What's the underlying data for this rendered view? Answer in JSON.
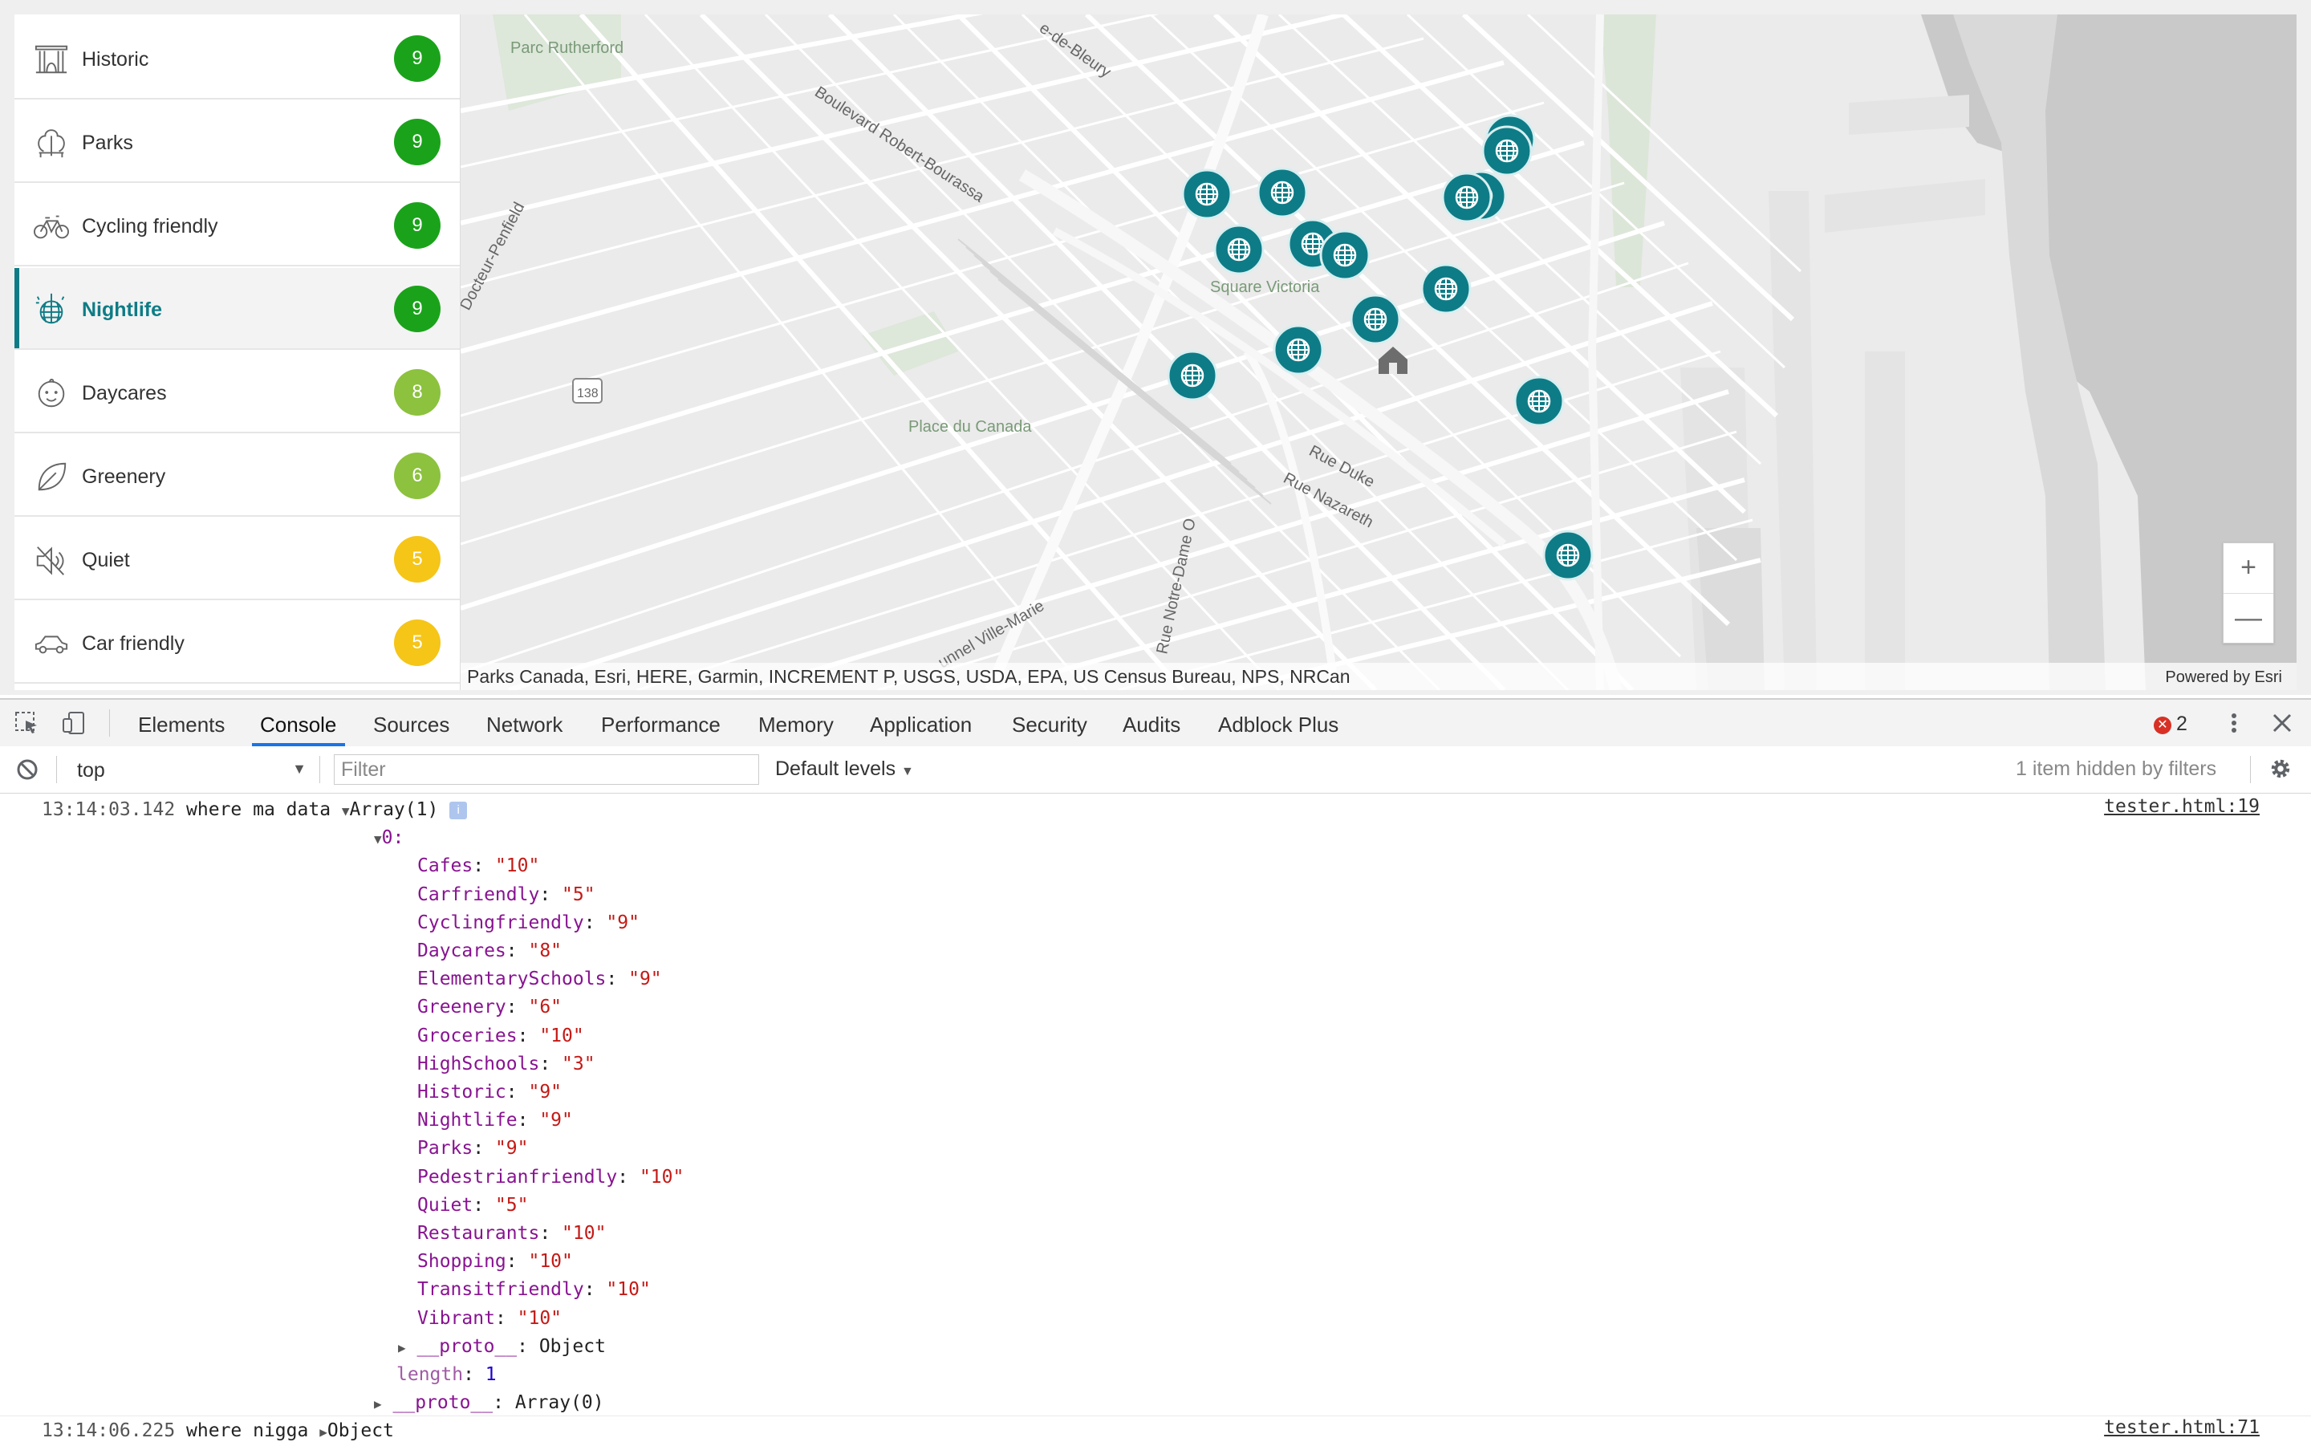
{
  "sidebar": {
    "items": [
      {
        "label": "Historic",
        "score": "9",
        "icon": "monument-icon",
        "color": "#1aa31a",
        "active": false
      },
      {
        "label": "Parks",
        "score": "9",
        "icon": "park-bench-icon",
        "color": "#1aa31a",
        "active": false
      },
      {
        "label": "Cycling friendly",
        "score": "9",
        "icon": "bicycle-icon",
        "color": "#1aa31a",
        "active": false
      },
      {
        "label": "Nightlife",
        "score": "9",
        "icon": "disco-ball-icon",
        "color": "#1aa31a",
        "active": true
      },
      {
        "label": "Daycares",
        "score": "8",
        "icon": "baby-face-icon",
        "color": "#8cc23e",
        "active": false
      },
      {
        "label": "Greenery",
        "score": "6",
        "icon": "leaf-icon",
        "color": "#8cc23e",
        "active": false
      },
      {
        "label": "Quiet",
        "score": "5",
        "icon": "mute-speaker-icon",
        "color": "#f5c518",
        "active": false
      },
      {
        "label": "Car friendly",
        "score": "5",
        "icon": "car-icon",
        "color": "#f5c518",
        "active": false
      }
    ]
  },
  "map": {
    "labels": {
      "parc_rutherford": "Parc Rutherford",
      "bleury": "e-de-Bleury",
      "robert_bourassa": "Boulevard Robert-Bourassa",
      "docteur_penfield": "Docteur-Penfield",
      "square_victoria": "Square Victoria",
      "place_du_canada": "Place du Canada",
      "route_138": "138",
      "rue_duke": "Rue Duke",
      "rue_nazareth": "Rue Nazareth",
      "notre_dame": "Rue Notre-Dame O",
      "ville_marie": "unnel Ville-Marie"
    },
    "zoom_in": "+",
    "zoom_out": "—",
    "attribution": "Parks Canada, Esri, HERE, Garmin, INCREMENT P, USGS, USDA, EPA, US Census Bureau, NPS, NRCan",
    "powered_prefix": "Powered by",
    "powered_brand": "Esri",
    "marker_color": "#0e7c86"
  },
  "devtools": {
    "tabs": [
      "Elements",
      "Console",
      "Sources",
      "Network",
      "Performance",
      "Memory",
      "Application",
      "Security",
      "Audits",
      "Adblock Plus"
    ],
    "active_tab": "Console",
    "error_count": "2",
    "context": "top",
    "filter_placeholder": "Filter",
    "levels": "Default levels",
    "hidden_note": "1 item hidden by filters"
  },
  "console": {
    "entry1": {
      "timestamp": "13:14:03.142",
      "message": "where ma data",
      "summary": "Array(1)",
      "source": "tester.html:19",
      "index_label": "0:",
      "properties": [
        {
          "key": "Cafes",
          "value": "\"10\""
        },
        {
          "key": "Carfriendly",
          "value": "\"5\""
        },
        {
          "key": "Cyclingfriendly",
          "value": "\"9\""
        },
        {
          "key": "Daycares",
          "value": "\"8\""
        },
        {
          "key": "ElementarySchools",
          "value": "\"9\""
        },
        {
          "key": "Greenery",
          "value": "\"6\""
        },
        {
          "key": "Groceries",
          "value": "\"10\""
        },
        {
          "key": "HighSchools",
          "value": "\"3\""
        },
        {
          "key": "Historic",
          "value": "\"9\""
        },
        {
          "key": "Nightlife",
          "value": "\"9\""
        },
        {
          "key": "Parks",
          "value": "\"9\""
        },
        {
          "key": "Pedestrianfriendly",
          "value": "\"10\""
        },
        {
          "key": "Quiet",
          "value": "\"5\""
        },
        {
          "key": "Restaurants",
          "value": "\"10\""
        },
        {
          "key": "Shopping",
          "value": "\"10\""
        },
        {
          "key": "Transitfriendly",
          "value": "\"10\""
        },
        {
          "key": "Vibrant",
          "value": "\"10\""
        }
      ],
      "proto_obj_key": "__proto__",
      "proto_obj_val": "Object",
      "length_key": "length",
      "length_val": "1",
      "proto_arr_key": "__proto__",
      "proto_arr_val": "Array(0)"
    },
    "entry2": {
      "timestamp": "13:14:06.225",
      "message": "where nigga",
      "summary": "Object",
      "source": "tester.html:71"
    }
  }
}
